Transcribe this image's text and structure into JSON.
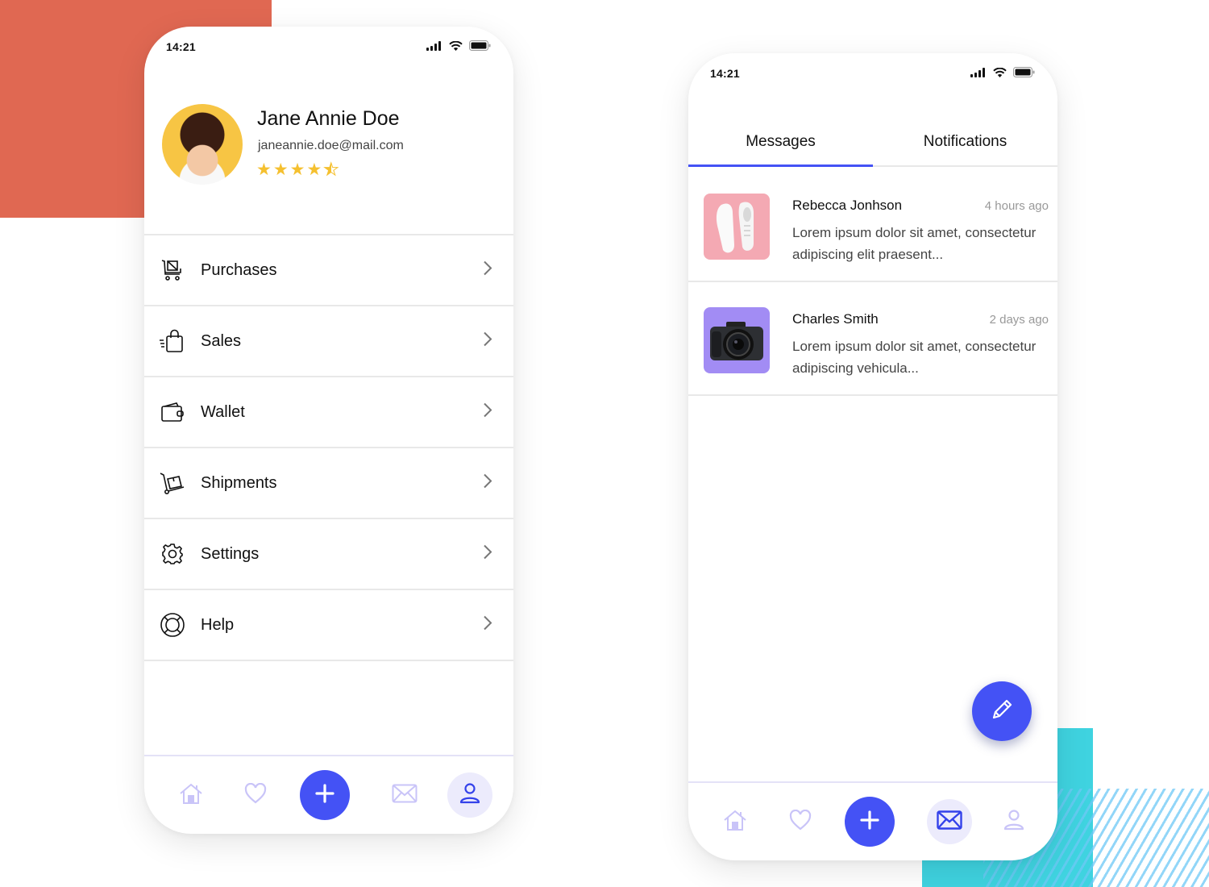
{
  "colors": {
    "accent": "#4452f5",
    "accent_soft": "#ecebfc",
    "nav_inactive": "#c9c4f8",
    "star": "#f5c02f",
    "deco_orange": "#e06852",
    "deco_cyan": "#3fd3e0"
  },
  "profile_screen": {
    "status_bar": {
      "time": "14:21",
      "icons": [
        "signal-icon",
        "wifi-icon",
        "battery-icon"
      ]
    },
    "user": {
      "name": "Jane Annie Doe",
      "email": "janeannie.doe@mail.com",
      "rating": 4.5,
      "rating_max": 5
    },
    "menu": [
      {
        "label": "Purchases",
        "icon": "shopping-cart-icon"
      },
      {
        "label": "Sales",
        "icon": "shopping-bag-icon"
      },
      {
        "label": "Wallet",
        "icon": "wallet-icon"
      },
      {
        "label": "Shipments",
        "icon": "hand-truck-icon"
      },
      {
        "label": "Settings",
        "icon": "gear-icon"
      },
      {
        "label": "Help",
        "icon": "lifebuoy-icon"
      }
    ],
    "bottom_nav": {
      "items": [
        "home-icon",
        "heart-icon",
        "plus-icon",
        "mail-icon",
        "user-icon"
      ],
      "active": "user-icon"
    }
  },
  "messages_screen": {
    "status_bar": {
      "time": "14:21",
      "icons": [
        "signal-icon",
        "wifi-icon",
        "battery-icon"
      ]
    },
    "tabs": [
      {
        "label": "Messages",
        "active": true
      },
      {
        "label": "Notifications",
        "active": false
      }
    ],
    "messages": [
      {
        "sender": "Rebecca Jonhson",
        "time": "4 hours ago",
        "preview": "Lorem ipsum dolor sit amet, consectetur adipiscing elit praesent...",
        "thumbnail": "sneakers-image"
      },
      {
        "sender": "Charles Smith",
        "time": "2 days ago",
        "preview": "Lorem ipsum dolor sit amet, consectetur adipiscing vehicula...",
        "thumbnail": "camera-image"
      }
    ],
    "fab_icon": "pencil-icon",
    "bottom_nav": {
      "items": [
        "home-icon",
        "heart-icon",
        "plus-icon",
        "mail-icon",
        "user-icon"
      ],
      "active": "mail-icon"
    }
  }
}
